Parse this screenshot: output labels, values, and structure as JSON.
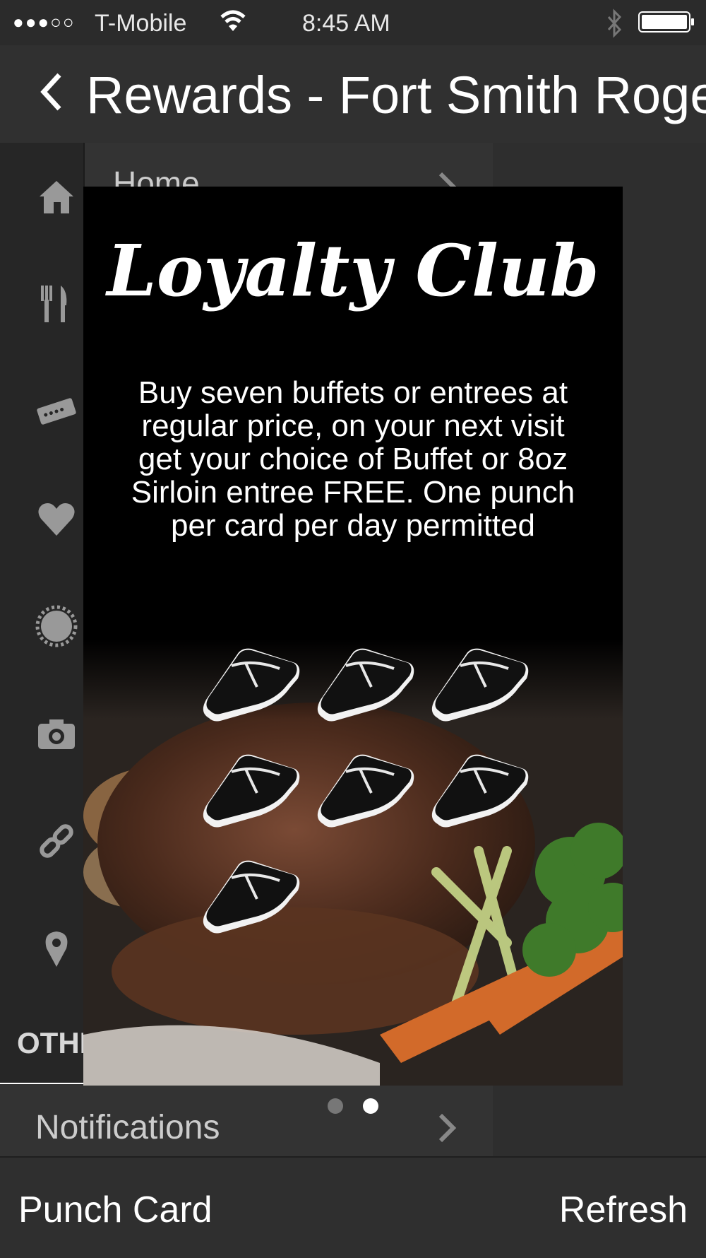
{
  "status": {
    "signal": "●●●○○",
    "carrier": "T-Mobile",
    "time": "8:45 AM"
  },
  "nav": {
    "title": "Rewards - Fort Smith Rogers"
  },
  "sidebar": {
    "items": [
      {
        "label": "Home",
        "icon": "home-icon"
      },
      {
        "label": "",
        "icon": "fork-knife-icon"
      },
      {
        "label": "",
        "icon": "ticket-icon"
      },
      {
        "label": "",
        "icon": "heart-icon"
      },
      {
        "label": "",
        "icon": "badge-icon"
      },
      {
        "label": "",
        "icon": "camera-icon"
      },
      {
        "label": "",
        "icon": "link-icon"
      },
      {
        "label": "",
        "icon": "map-pin-icon"
      }
    ],
    "section_header": "OTHER",
    "notifications_label": "Notifications"
  },
  "card": {
    "logo_text": "Loyalty Club",
    "description": "Buy seven buffets or entrees at regular price, on your next visit get your choice of Buffet or 8oz Sirloin entree FREE. One punch per card per day permitted",
    "punches_total": 7,
    "punches_filled": 0
  },
  "pager": {
    "pages": 2,
    "current": 2
  },
  "toolbar": {
    "left_label": "Punch Card",
    "right_label": "Refresh"
  },
  "colors": {
    "background": "#303030",
    "card": "#000000",
    "text": "#ffffff"
  }
}
